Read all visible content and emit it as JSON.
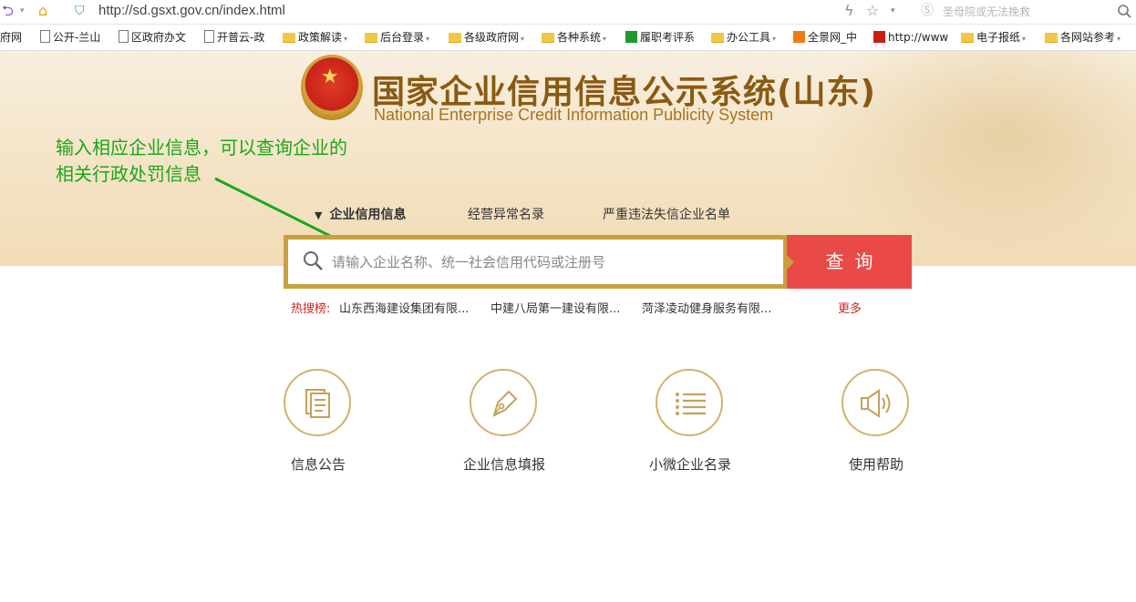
{
  "browser": {
    "url": "http://sd.gsxt.gov.cn/index.html",
    "search_placeholder": "圣母院或无法挽救"
  },
  "bookmarks": [
    {
      "label": "府网",
      "icon": "page"
    },
    {
      "label": "公开-兰山",
      "icon": "page"
    },
    {
      "label": "区政府办文",
      "icon": "page"
    },
    {
      "label": "开普云-政",
      "icon": "page"
    },
    {
      "label": "政策解读",
      "icon": "folder"
    },
    {
      "label": "后台登录",
      "icon": "folder"
    },
    {
      "label": "各级政府网",
      "icon": "folder"
    },
    {
      "label": "各种系统",
      "icon": "folder"
    },
    {
      "label": "履职考评系",
      "icon": "green-app"
    },
    {
      "label": "办公工具",
      "icon": "folder"
    },
    {
      "label": "全景网_中",
      "icon": "orange-logo"
    },
    {
      "label": "http://www",
      "icon": "red-logo"
    },
    {
      "label": "电子报纸",
      "icon": "folder"
    },
    {
      "label": "各网站参考",
      "icon": "folder"
    }
  ],
  "header": {
    "title_cn": "国家企业信用信息公示系统(山东)",
    "title_en": "National Enterprise Credit Information Publicity System"
  },
  "annotation": {
    "line1": "输入相应企业信息，可以查询企业的",
    "line2": "相关行政处罚信息"
  },
  "tabs": [
    {
      "label": "企业信用信息",
      "active": true
    },
    {
      "label": "经营异常名录",
      "active": false
    },
    {
      "label": "严重违法失信企业名单",
      "active": false
    }
  ],
  "search": {
    "placeholder": "请输入企业名称、统一社会信用代码或注册号",
    "button": "查询"
  },
  "hot": {
    "label": "热搜榜:",
    "items": [
      "山东西海建设集团有限...",
      "中建八局第一建设有限...",
      "菏泽凌动健身服务有限..."
    ],
    "more": "更多"
  },
  "features": [
    {
      "label": "信息公告",
      "icon": "document-icon"
    },
    {
      "label": "企业信息填报",
      "icon": "pen-icon"
    },
    {
      "label": "小微企业名录",
      "icon": "list-icon"
    },
    {
      "label": "使用帮助",
      "icon": "speaker-icon"
    }
  ],
  "colors": {
    "accent_gold": "#c9a040",
    "button_red": "#e94a48",
    "annotation_green": "#19a819",
    "hot_red": "#d0281f"
  }
}
